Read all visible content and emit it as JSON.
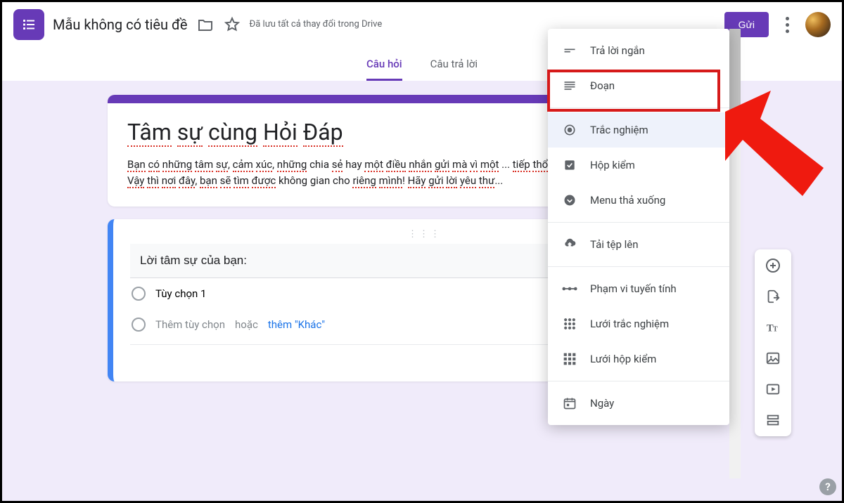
{
  "header": {
    "form_title": "Mẫu không có tiêu đề",
    "save_status": "Đã lưu tất cả thay đổi trong Drive",
    "send_label": "Gửi"
  },
  "tabs": {
    "questions": "Câu hỏi",
    "responses": "Câu trả lời"
  },
  "title_card": {
    "heading": "Tâm sự cùng Hỏi Đáp",
    "desc_line1": "Bạn có những tâm sự, cảm xúc, những chia sẻ hay một điều nhắn gửi mà vì một lý do nào đó chưa thể trực tiếp thổ lộ?",
    "desc_line2": "Vậy thì nơi đây, bạn sẽ tìm được không gian cho riêng mình! Hãy gửi lời yêu thương..."
  },
  "question": {
    "prompt": "Lời tâm sự của bạn:",
    "option1": "Tùy chọn 1",
    "add_option": "Thêm tùy chọn",
    "or_word": "hoặc",
    "add_other": "thêm \"Khác\""
  },
  "qtype_menu": {
    "short_answer": "Trả lời ngắn",
    "paragraph": "Đoạn",
    "multiple_choice": "Trắc nghiệm",
    "checkboxes": "Hộp kiểm",
    "dropdown": "Menu thả xuống",
    "file_upload": "Tải tệp lên",
    "linear_scale": "Phạm vi tuyến tính",
    "mc_grid": "Lưới trắc nghiệm",
    "checkbox_grid": "Lưới hộp kiểm",
    "date": "Ngày"
  },
  "help": "?"
}
